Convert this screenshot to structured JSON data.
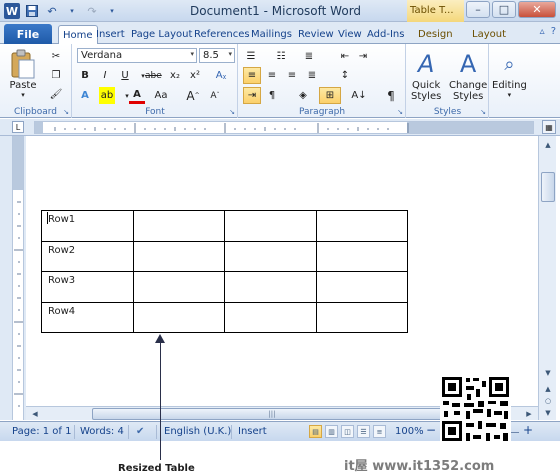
{
  "window": {
    "title": "Document1 - Microsoft Word",
    "context_tab_header": "Table T...",
    "controls": [
      "–",
      "□",
      "✕"
    ]
  },
  "quick_access": {
    "icons": [
      "word-logo",
      "save-icon",
      "undo-icon",
      "redo-icon",
      "customize-icon"
    ],
    "undo_glyph": "↶",
    "redo_glyph": "↷",
    "logo_letter": "W"
  },
  "tabs": {
    "file": "File",
    "items": [
      "Home",
      "Insert",
      "Page Layout",
      "References",
      "Mailings",
      "Review",
      "View",
      "Add-Ins"
    ],
    "context_items": [
      "Design",
      "Layout"
    ],
    "active": "Home"
  },
  "ribbon": {
    "clipboard": {
      "label": "Clipboard",
      "paste": "Paste"
    },
    "font": {
      "label": "Font",
      "font_name": "Verdana",
      "font_size": "8.5",
      "buttons": [
        "B",
        "I",
        "U",
        "abe",
        "x₂",
        "x²",
        "Aa",
        "A",
        "A",
        "Aa"
      ]
    },
    "paragraph": {
      "label": "Paragraph"
    },
    "styles": {
      "label": "Styles",
      "quick_styles": "Quick",
      "quick_styles_2": "Styles",
      "change_styles": "Change",
      "change_styles_2": "Styles"
    },
    "editing": {
      "label": "Editing"
    }
  },
  "document": {
    "table": {
      "rows": [
        [
          "Row1",
          "",
          "",
          ""
        ],
        [
          "Row2",
          "",
          "",
          ""
        ],
        [
          "Row3",
          "",
          "",
          ""
        ],
        [
          "Row4",
          "",
          "",
          ""
        ]
      ]
    }
  },
  "statusbar": {
    "page": "Page: 1 of 1",
    "words": "Words: 4",
    "language": "English (U.K.)",
    "mode": "Insert",
    "zoom": "100%",
    "zoom_minus": "−",
    "zoom_plus": "+"
  },
  "annotation": {
    "caption": "Resized Table",
    "watermark": "it屋 www.it1352.com"
  }
}
